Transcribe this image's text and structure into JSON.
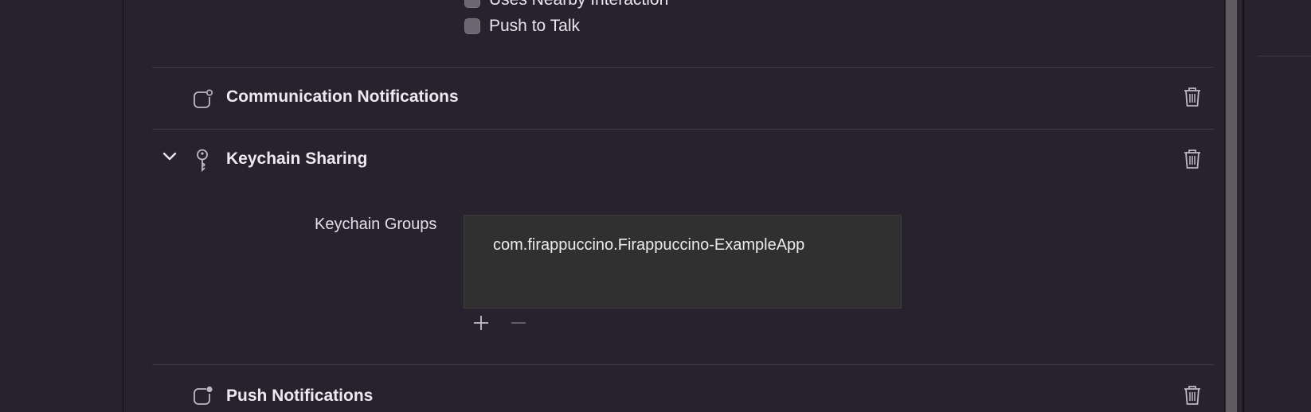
{
  "top_options": [
    {
      "label": "Uses Nearby Interaction",
      "checked": false
    },
    {
      "label": "Push to Talk",
      "checked": false
    }
  ],
  "capabilities": {
    "communication_notifications": {
      "title": "Communication Notifications",
      "icon": "capability-app-badge-icon"
    },
    "keychain_sharing": {
      "title": "Keychain Sharing",
      "icon": "key-icon",
      "expanded": true,
      "groups_label": "Keychain Groups",
      "groups": [
        "com.firappuccino.Firappuccino-ExampleApp"
      ]
    },
    "push_notifications": {
      "title": "Push Notifications",
      "icon": "capability-app-badge-icon"
    }
  },
  "controls": {
    "add_icon": "plus-icon",
    "remove_icon": "minus-icon",
    "delete_icon": "trash-icon",
    "expand_icon": "chevron-down-icon"
  },
  "colors": {
    "background": "#28222e",
    "list_box": "#313031",
    "separator": "#413b46"
  }
}
